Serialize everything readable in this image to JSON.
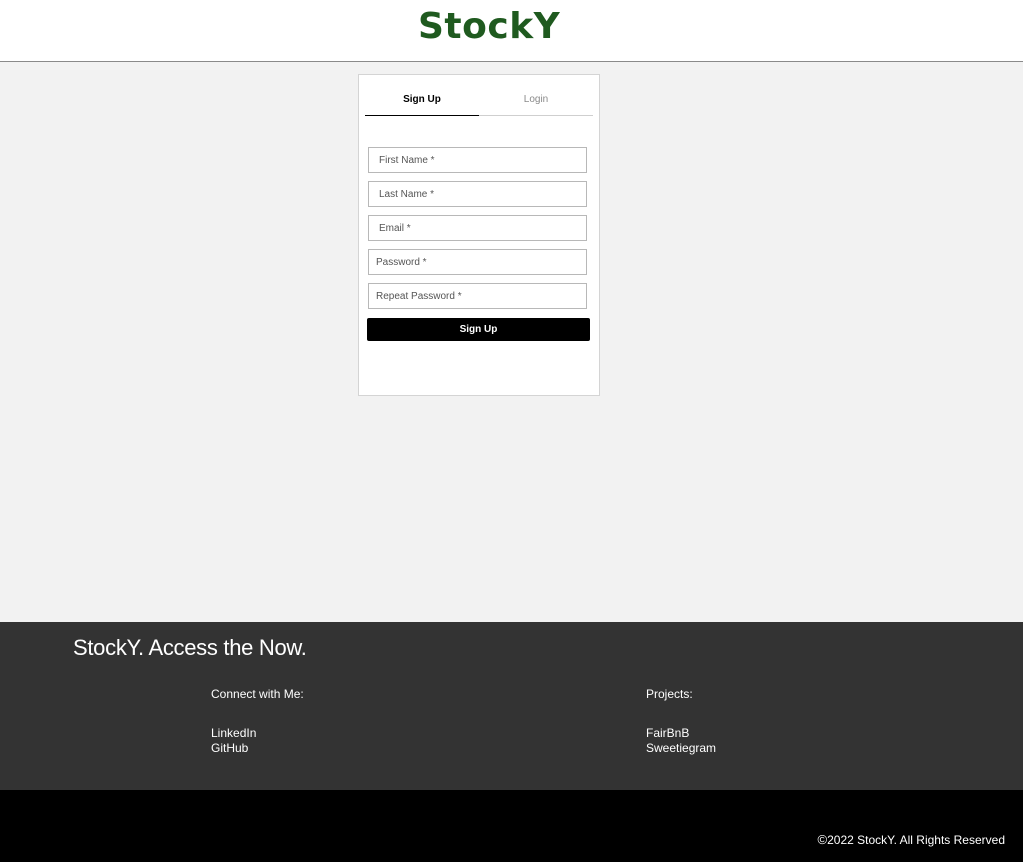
{
  "header": {
    "logo": "StockY"
  },
  "auth": {
    "tabs": {
      "signup": "Sign Up",
      "login": "Login"
    },
    "fields": {
      "first_name": "First Name *",
      "last_name": "Last Name *",
      "email": "Email *",
      "password": "Password *",
      "repeat_password": "Repeat Password *"
    },
    "submit_label": "Sign Up"
  },
  "footer": {
    "tagline": "StockY. Access the Now.",
    "connect": {
      "heading": "Connect with Me:",
      "links": [
        "LinkedIn",
        "GitHub"
      ]
    },
    "projects": {
      "heading": "Projects:",
      "links": [
        "FairBnB",
        "Sweetiegram"
      ]
    }
  },
  "bottom_bar": {
    "copyright_symbol": "©",
    "copyright_text": "2022 StockY. All Rights Reserved"
  },
  "colors": {
    "brand_green": "#1f5a1f",
    "page_bg": "#f2f2f2",
    "footer_bg": "#333333",
    "bottom_bar_bg": "#000000",
    "button_bg": "#000000"
  }
}
